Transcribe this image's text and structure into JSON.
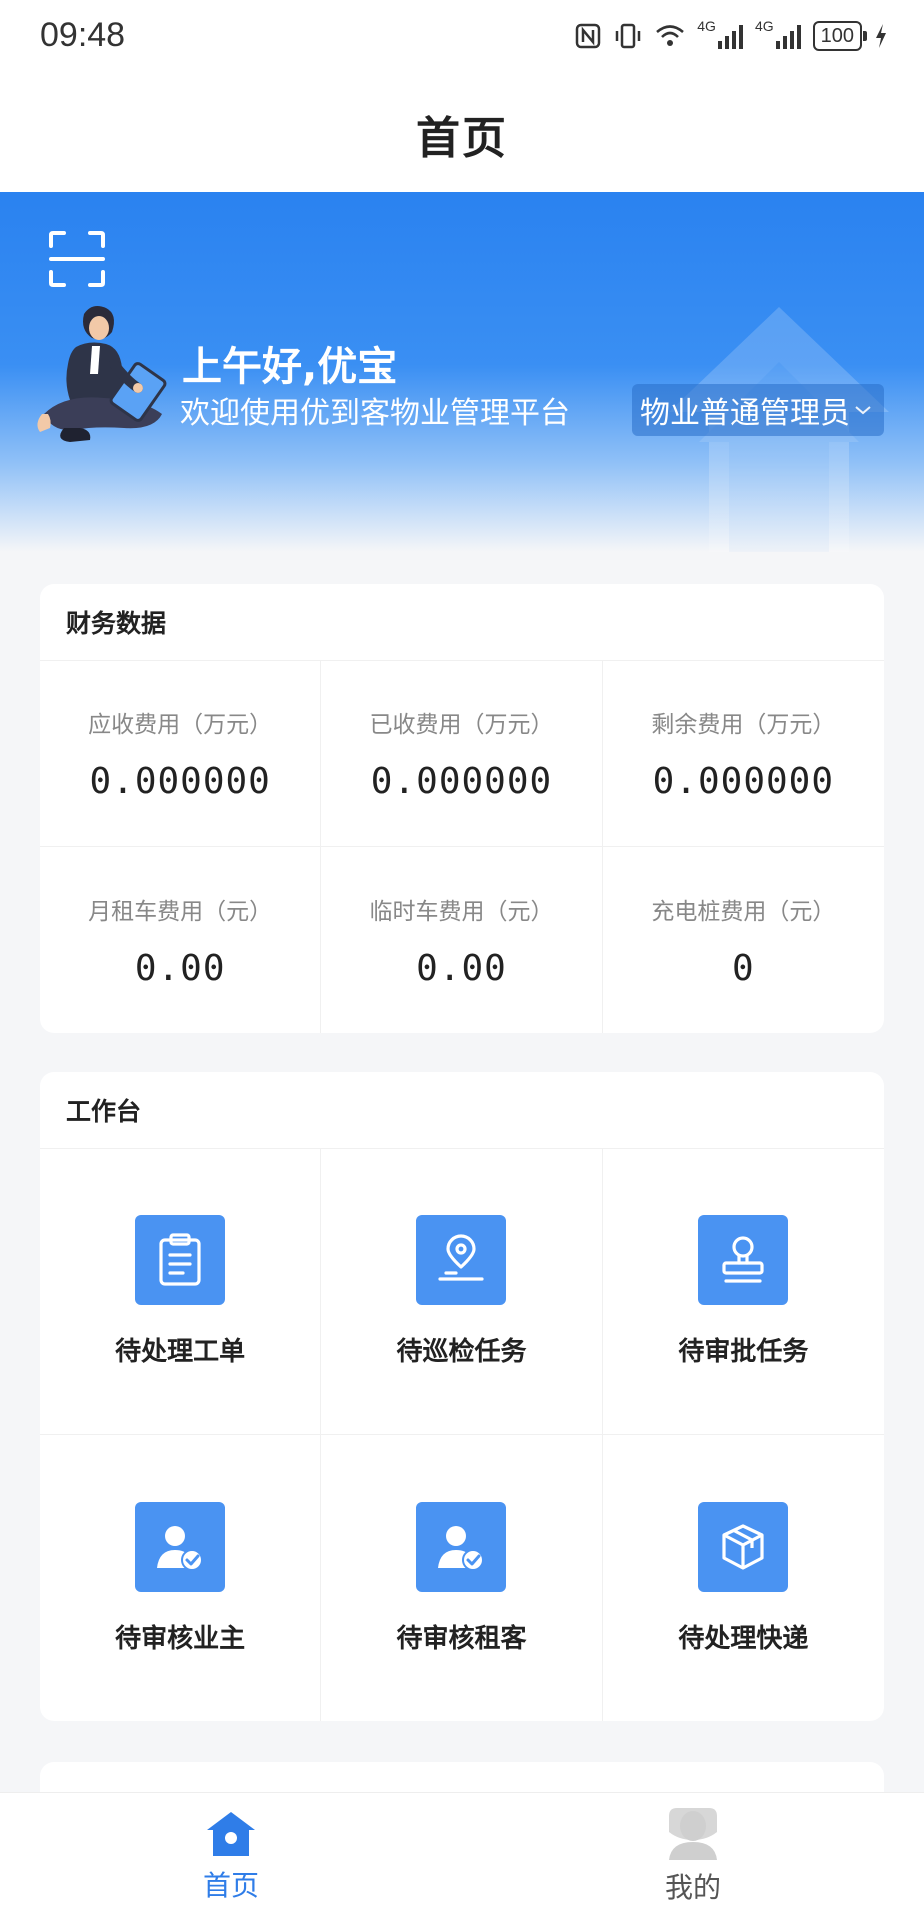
{
  "status_bar": {
    "time": "09:48",
    "network_1": "4G",
    "network_2": "4G",
    "battery": "100"
  },
  "header": {
    "title": "首页"
  },
  "hero": {
    "greeting": "上午好,优宝",
    "welcome": "欢迎使用优到客物业管理平台",
    "role": "物业普通管理员"
  },
  "finance": {
    "title": "财务数据",
    "items": [
      {
        "label": "应收费用（万元）",
        "value": "0.000000"
      },
      {
        "label": "已收费用（万元）",
        "value": "0.000000"
      },
      {
        "label": "剩余费用（万元）",
        "value": "0.000000"
      },
      {
        "label": "月租车费用（元）",
        "value": "0.00"
      },
      {
        "label": "临时车费用（元）",
        "value": "0.00"
      },
      {
        "label": "充电桩费用（元）",
        "value": "0"
      }
    ]
  },
  "workbench": {
    "title": "工作台",
    "items": [
      {
        "label": "待处理工单",
        "icon": "clipboard-icon"
      },
      {
        "label": "待巡检任务",
        "icon": "location-pin-icon"
      },
      {
        "label": "待审批任务",
        "icon": "stamp-icon"
      },
      {
        "label": "待审核业主",
        "icon": "user-check-icon"
      },
      {
        "label": "待审核租客",
        "icon": "user-check-icon"
      },
      {
        "label": "待处理快递",
        "icon": "package-icon"
      }
    ]
  },
  "tabbar": {
    "tabs": [
      {
        "label": "首页",
        "icon": "home-icon",
        "active": true
      },
      {
        "label": "我的",
        "icon": "profile-icon",
        "active": false
      }
    ]
  },
  "colors": {
    "primary": "#2f7de8",
    "tile": "#4a93f2",
    "hero_top": "#2a82f0",
    "background": "#f5f6f8"
  }
}
